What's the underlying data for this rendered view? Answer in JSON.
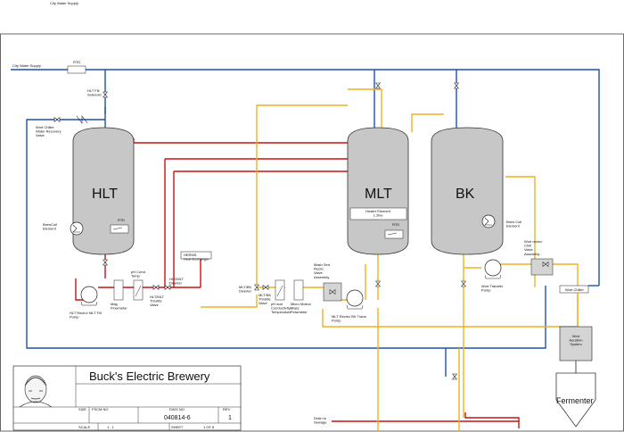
{
  "colors": {
    "water": "#1e4fb5",
    "hot": "#cc1111",
    "wort": "#f0b020",
    "tank_fill": "#c7c7c7",
    "tank_stroke": "#333333"
  },
  "top_caption": "City Water Supply",
  "labels": {
    "city_water": "City Water Supply",
    "rtd": "RTD",
    "hlt_fill": "HLT Fill\nSolenoid",
    "wort_chiller_recovery": "Wort Chiller\nWater Recovery\nValve",
    "brewcoil_element": "BrewColl\nElement",
    "herms": "HERMS\nHeat Exchanger",
    "mag_flowmeter": "Mag\nFlowmeter",
    "ph_cond_temp": "pH Cond\nTemp",
    "hlt_throttle": "HLT/MLT\nThrottle\nValve",
    "hlt_diverter": "HLT/MLT\nDiverter",
    "hlt_recirc_pump": "HLT Recirc/ MLT Fill\nPump",
    "mlt_bk_diverter": "MLT/BK\nDiverter",
    "mlt_bk_throttle": "MLT/BK\nThrottle\nValve",
    "ph_conductivity": "pH and\nConductivity/\nTemperature",
    "micro_motion": "Micro Motion\nMass\nFlowmeter",
    "mash_sed": "Mash Sed\nRecirc\nValve\nAssembly",
    "mlt_recirc_pump": "MLT Recirc/ BK Trans\nPump",
    "heater_element": "Heater Element\n1.2kw",
    "wort_transfer_pump": "Wort Transfer\nPump",
    "brew_coil_element_bk": "Brew Coil\nElement",
    "wort_recirc_chill": "Wort recirc/\nChill\nValve\nAssembly",
    "wort_chiller": "Wort Chiller",
    "wort_aeration": "Wort\nAeration\nSystem",
    "fermenter": "Fermenter",
    "drain": "Drain to\nSewage"
  },
  "tanks": {
    "hlt": "HLT",
    "mlt": "MLT",
    "bk": "BK"
  },
  "title_block": {
    "title": "Buck's Electric Brewery",
    "size_label": "SIZE",
    "fscm_label": "FSCM NO",
    "dwg_label": "DWG NO",
    "rev_label": "REV",
    "dwg_no": "040814-6",
    "rev": "1",
    "scale_label": "SCALE",
    "scale": "1 : 1",
    "sheet_label": "SHEET",
    "sheet": "1 OF 8"
  }
}
